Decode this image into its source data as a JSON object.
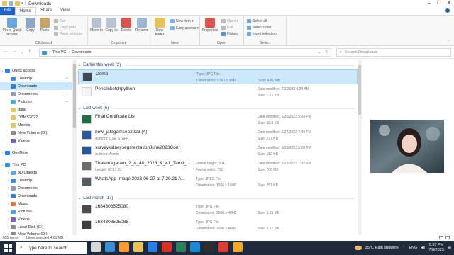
{
  "window": {
    "title": "Downloads"
  },
  "tabs": [
    "File",
    "Home",
    "Share",
    "View"
  ],
  "ribbon": {
    "clipboard": {
      "label": "Clipboard",
      "pin": "Pin to Quick access",
      "copy": "Copy",
      "paste": "Paste",
      "cut": "Cut",
      "copy_path": "Copy path",
      "paste_shortcut": "Paste shortcut"
    },
    "organize": {
      "label": "Organize",
      "move_to": "Move to",
      "copy_to": "Copy to",
      "delete": "Delete",
      "rename": "Rename"
    },
    "new": {
      "label": "New",
      "new_folder": "New folder",
      "new_item": "New item ▾",
      "easy_access": "Easy access ▾"
    },
    "open": {
      "label": "Open",
      "properties": "Properties",
      "open": "Open ▾",
      "edit": "Edit",
      "history": "History"
    },
    "select": {
      "label": "Select",
      "select_all": "Select all",
      "select_none": "Select none",
      "invert": "Invert selection"
    }
  },
  "address": {
    "parts": [
      "This PC",
      "Downloads"
    ],
    "search_placeholder": "Search Downloads"
  },
  "sidebar": [
    {
      "label": "Quick access",
      "icon": "star-icon",
      "color": "#2b7de9",
      "chev": "⌄"
    },
    {
      "label": "Desktop",
      "icon": "desktop-icon",
      "color": "#3a8fd8",
      "pin": "📌"
    },
    {
      "label": "Downloads",
      "icon": "download-icon",
      "color": "#2f7fd6",
      "pin": "📌",
      "selected": true
    },
    {
      "label": "Documents",
      "icon": "document-icon",
      "color": "#8c9fb5",
      "pin": "📌"
    },
    {
      "label": "Pictures",
      "icon": "picture-icon",
      "color": "#4aa3df",
      "pin": "📌"
    },
    {
      "label": "data",
      "icon": "folder-icon",
      "color": "#e8c25b"
    },
    {
      "label": "DBMS2022",
      "icon": "folder-icon",
      "color": "#e8c25b"
    },
    {
      "label": "Movies",
      "icon": "folder-icon",
      "color": "#e8c25b"
    },
    {
      "label": "New Volume (D:)",
      "icon": "drive-icon",
      "color": "#8a8a8a"
    },
    {
      "label": "Videos",
      "icon": "video-icon",
      "color": "#7a5cc6"
    },
    {
      "label": "OneDrive",
      "icon": "cloud-icon",
      "color": "#2b7de9",
      "chev": "›"
    },
    {
      "label": "This PC",
      "icon": "pc-icon",
      "color": "#3a8fd8",
      "chev": "⌄"
    },
    {
      "label": "3D Objects",
      "icon": "cube-icon",
      "color": "#5aa9e6",
      "chev": "›"
    },
    {
      "label": "Desktop",
      "icon": "desktop-icon",
      "color": "#3a8fd8",
      "chev": "›"
    },
    {
      "label": "Documents",
      "icon": "document-icon",
      "color": "#8c9fb5",
      "chev": "›"
    },
    {
      "label": "Downloads",
      "icon": "download-icon",
      "color": "#2f7fd6",
      "chev": "›"
    },
    {
      "label": "Music",
      "icon": "music-icon",
      "color": "#e56b3b",
      "chev": "›"
    },
    {
      "label": "Pictures",
      "icon": "picture-icon",
      "color": "#4aa3df",
      "chev": "›"
    },
    {
      "label": "Videos",
      "icon": "video-icon",
      "color": "#7a5cc6",
      "chev": "›"
    },
    {
      "label": "Local Disk (C:)",
      "icon": "drive-icon",
      "color": "#8a8a8a",
      "chev": "›"
    },
    {
      "label": "New Volume (D:)",
      "icon": "drive-icon",
      "color": "#8a8a8a",
      "chev": "›"
    }
  ],
  "groups": [
    {
      "header": "Earlier this week (2)",
      "files": [
        {
          "name": "Demo",
          "meta": "",
          "c2a": "Type: JPG File",
          "c2b": "Dimensions: 5760 x 3840",
          "c3a": "",
          "c3b": "Size: 4.61 MB",
          "thumb": "#3b4a57",
          "selected": true
        },
        {
          "name": "Pencilsketchpython",
          "meta": "",
          "c2a": "",
          "c2b": "",
          "c3a": "Date modified: 7/2/2023 9:24 AM",
          "c3b": "Size: 1.61 KB",
          "thumb": "#f3f3f3"
        }
      ]
    },
    {
      "header": "Last week (5)",
      "files": [
        {
          "name": "Final Certificate List",
          "meta": "",
          "c2a": "",
          "c2b": "",
          "c3a": "Date modified: 6/30/2023 5:24 PM",
          "c3b": "Size: 68.9 KB",
          "thumb": "#1d6f42"
        },
        {
          "name": "new_jatagamsep2023 (4)",
          "meta": "Authors: CSE STAFF",
          "c2a": "",
          "c2b": "",
          "c3a": "Date modified: 6/27/2023 7:49 PM",
          "c3b": "Size: 277 KB",
          "thumb": "#2b579a"
        },
        {
          "name": "surveykidneysegmentationJune2023Conf",
          "meta": "Authors: Admin",
          "c2a": "",
          "c2b": "",
          "c3a": "Date modified: 6/25/2023 5:28 PM",
          "c3b": "Size: 182 KB",
          "thumb": "#2b579a"
        },
        {
          "name": "Thalainagaram_2_&_40_2023_&_41_Tamil_...",
          "meta": "Length: 02:17:31",
          "c2a": "Frame height: 304",
          "c2b": "Frame width: 720",
          "c3a": "Date modified: 6/29/2023 1:32 PM",
          "c3b": "Size: 706 MB",
          "thumb": "#6d6d6d"
        },
        {
          "name": "WhatsApp Image 2023-06-27 at 7.20.21 A...",
          "meta": "",
          "c2a": "Type: JPEG File",
          "c2b": "Dimensions: 1066 x 1600",
          "c3a": "",
          "c3b": "Size: 251 KB",
          "thumb": "#555b63"
        }
      ]
    },
    {
      "header": "Last month (17)",
      "files": [
        {
          "name": "1684308525080",
          "meta": "",
          "c2a": "Type: JPG File",
          "c2b": "Dimensions: 3000 x 4000",
          "c3a": "",
          "c3b": "Size: 3.85 MB",
          "thumb": "#4a4a4a"
        },
        {
          "name": "1684308525088",
          "meta": "",
          "c2a": "Type: JPG File",
          "c2b": "Dimensions: 3000 x 4000",
          "c3a": "",
          "c3b": "Size: 3.67 MB",
          "thumb": "#3e3e3e"
        }
      ]
    }
  ],
  "status": {
    "count": "655 items",
    "selected": "1 item selected  4.61 MB"
  },
  "taskbar": {
    "search_placeholder": "Type here to search",
    "weather": "35°C  Rain showers",
    "time": "5:37 PM",
    "date": "7/8/2023",
    "lang": "ENG"
  }
}
